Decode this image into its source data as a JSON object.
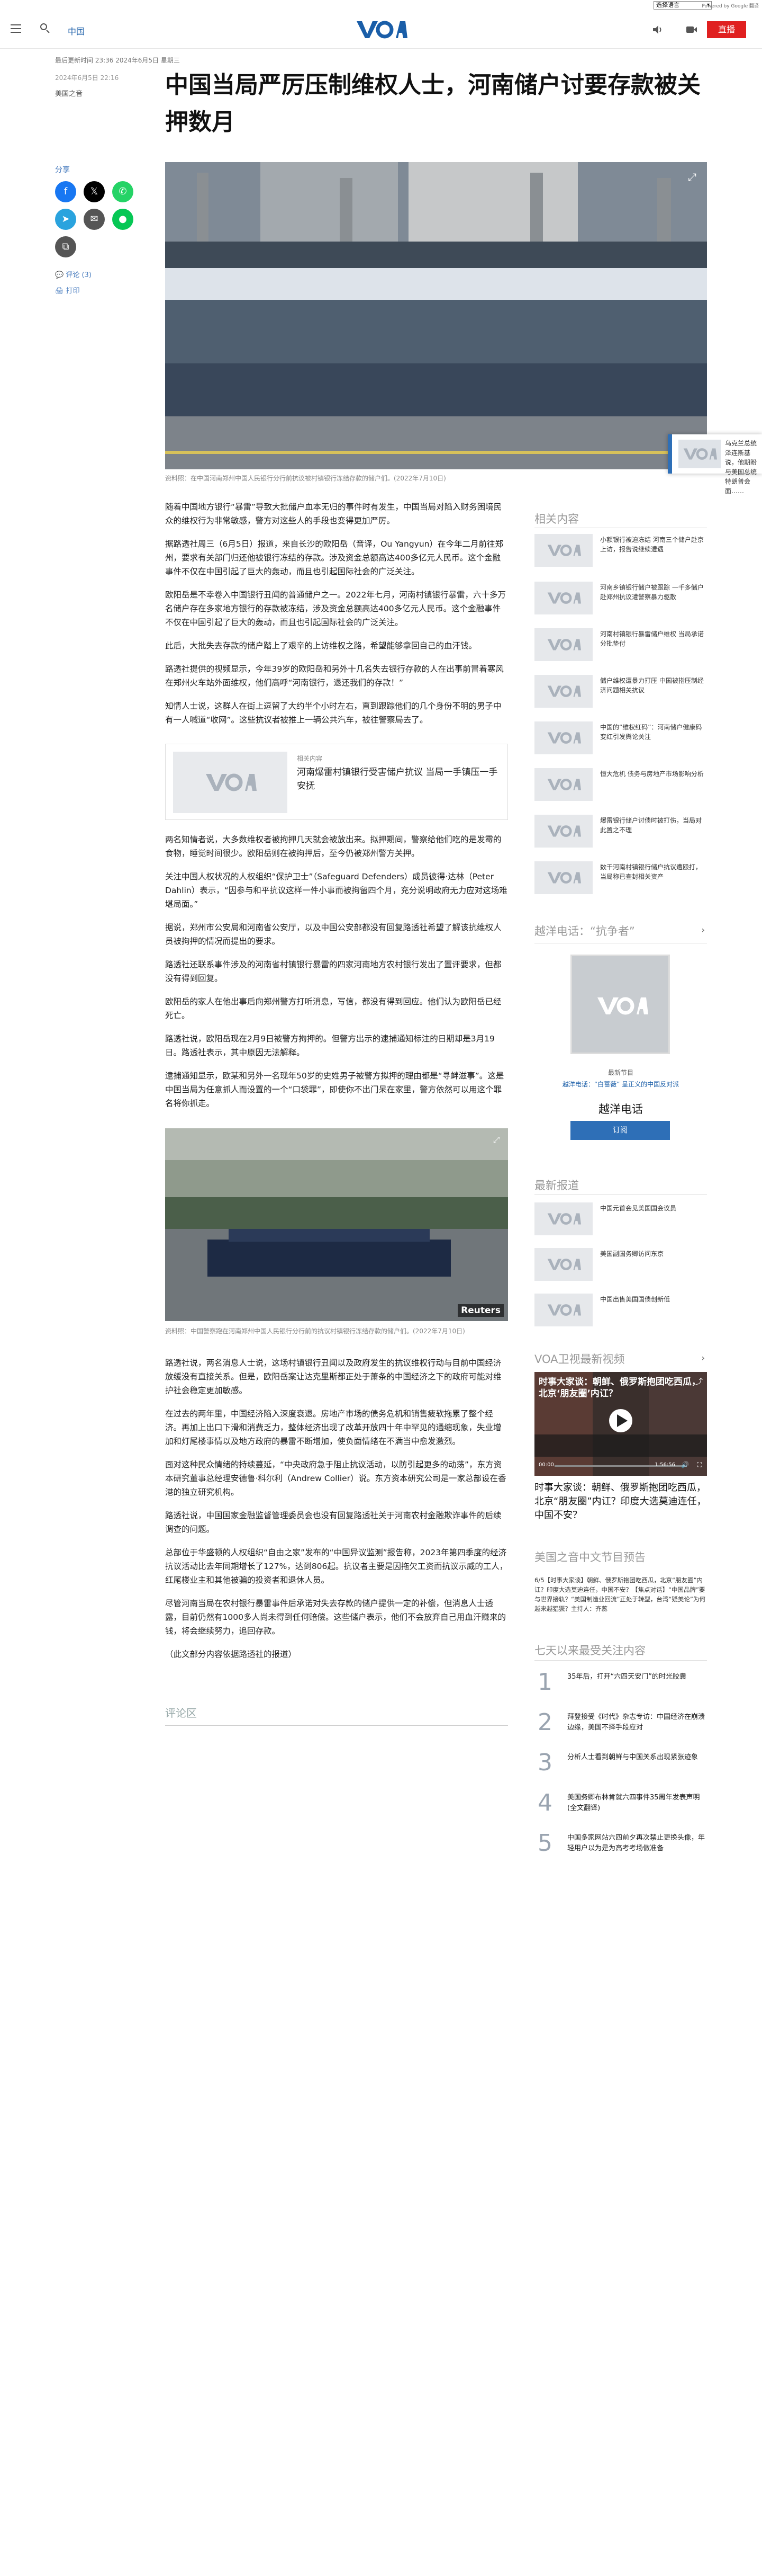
{
  "util": {
    "language_select": "选择语言",
    "google_translate": "Powered by Google 翻译"
  },
  "header": {
    "section": "中国",
    "live_label": "直播"
  },
  "article": {
    "dateline": "最后更新时间 23:36 2024年6月5日 星期三",
    "published": "2024年6月5日 22:16",
    "author": "美国之音",
    "title": "中国当局严厉压制维权人士，河南储户讨要存款被关押数月",
    "hero_caption": "资料照：在中国河南郑州中国人民银行分行前抗议被村镇银行冻结存款的储户们。(2022年7月10日)",
    "paragraphs_a": [
      "随着中国地方银行“暴雷”导致大批储户血本无归的事件时有发生，中国当局对陷入财务困境民众的维权行为非常敏感，警方对这些人的手段也变得更加严厉。",
      "据路透社周三（6月5日）报道，来自长沙的欧阳岳（音译，Ou Yangyun）在今年二月前往郑州，要求有关部门归还他被银行冻结的存款。涉及资金总额高达400多亿元人民币。这个金融事件不仅在中国引起了巨大的轰动，而且也引起国际社会的广泛关注。",
      "欧阳岳是不幸卷入中国银行丑闻的普通储户之一。2022年七月，河南村镇银行暴雷，六十多万名储户存在多家地方银行的存款被冻结，涉及资金总额高达400多亿元人民币。这个金融事件不仅在中国引起了巨大的轰动，而且也引起国际社会的广泛关注。",
      "此后，大批失去存款的储户踏上了艰辛的上访维权之路，希望能够拿回自己的血汗钱。",
      "路透社提供的视频显示，今年39岁的欧阳岳和另外十几名失去银行存款的人在出事前冒着寒风在郑州火车站外面维权，他们高呼“河南银行，退还我们的存款！”",
      "知情人士说，这群人在街上逗留了大约半个小时左右，直到跟踪他们的几个身份不明的男子中有一人喊道“收网”。这些抗议者被推上一辆公共汽车，被往警察局去了。"
    ],
    "related_inline": {
      "kicker": "相关内容",
      "title": "河南爆雷村镇银行受害储户抗议 当局一手镇压一手安抚"
    },
    "paragraphs_b": [
      "两名知情者说，大多数维权者被拘押几天就会被放出来。拟押期间，警察给他们吃的是发霉的食物，睡觉时间很少。欧阳岳则在被拘押后，至今仍被郑州警方关押。",
      "关注中国人权状况的人权组织“保护卫士”（Safeguard Defenders）成员彼得·达林（Peter Dahlin）表示，“因参与和平抗议这样一件小事而被拘留四个月，充分说明政府无力应对这场难堪局面。”",
      "据说，郑州市公安局和河南省公安厅，以及中国公安部都没有回复路透社希望了解该抗维权人员被拘押的情况而提出的要求。",
      "路透社还联系事件涉及的河南省村镇银行暴雷的四家河南地方农村银行发出了置评要求，但都没有得到回复。",
      "欧阳岳的家人在他出事后向郑州警方打听消息，写信，都没有得到回应。他们认为欧阳岳已经死亡。",
      "路透社说，欧阳岳现在2月9日被警方拘押的。但警方出示的逮捕通知标注的日期却是3月19日。路透社表示，其中原因无法解释。",
      "逮捕通知显示，欧某和另外一名现年50岁的史姓男子被警方拟押的理由都是“寻衅滋事”。这是中国当局为任意抓人而设置的一个“口袋罪”，即使你不出门呆在家里，警方依然可以用这个罪名将你抓走。"
    ],
    "image2_caption": "资料照：中国警察跑在河南郑州中国人民银行分行前的抗议村镇银行冻结存款的储户们。(2022年7月10日)",
    "image2_credit": "Reuters",
    "paragraphs_c": [
      "路透社说，两名消息人士说，这场村镇银行丑闻以及政府发生的抗议维权行动与目前中国经济放缓没有直接关系。但是，欧阳岳案让达克里斯都正处于萧条的中国经济之下的政府可能对维护社会稳定更加敏感。",
      "在过去的两年里，中国经济陷入深度衰退。房地产市场的债务危机和销售疲软拖累了整个经济。再加上出口下滑和消费乏力，整体经济出现了改革开放四十年中罕见的通缩现象，失业增加和灯尾楼事情以及地方政府的暴雷不断增加，使负面情绪在不满当中愈发激烈。",
      "面对这种民众情绪的持续蔓延，“中央政府急于阻止抗议活动，以防引起更多的动荡”，东方资本研究董事总经理安德鲁·科尔利（Andrew Collier）说。东方资本研究公司是一家总部设在香港的独立研究机构。",
      "路透社说，中国国家金融监督管理委员会也没有回复路透社关于河南农村金融欺诈事件的后续调查的问题。",
      "总部位于华盛顿的人权组织“自由之家”发布的“中国异议监测”报告称，2023年第四季度的经济抗议活动比去年同期增长了127%，达到806起。抗议者主要是因拖欠工资而抗议示威的工人，红尾楼业主和其他被骗的投资者和退休人员。",
      "尽管河南当局在农村银行暴雷事件后承诺对失去存款的储户提供一定的补偿，但消息人士透露，目前仍然有1000多人尚未得到任何赔偿。这些储户表示，他们不会放弃自己用血汗赚来的钱，将会继续努力，追回存款。",
      "（此文部分内容依据路透社的报道）"
    ],
    "comments_label": "评论区"
  },
  "share": {
    "label": "分享",
    "comment_link": "评论 (3)",
    "print_link": "打印"
  },
  "floating": {
    "text": "乌克兰总统泽连斯基说，他期盼与美国总统特朗普会面……"
  },
  "sidebar": {
    "related_title": "相关内容",
    "related": [
      "小额银行被迫冻结 河南三个储户赴京上访，报告说继续遭遇",
      "河南乡镇银行储户被跟踪 一千多储户赴郑州抗议遭警察暴力驱散",
      "河南村镇银行暴雷储户维权 当局承诺分批垫付",
      "储户维权遭暴力打压 中国被指压制经济问题相关抗议",
      "中国的“维权红码”：河南储户健康码变红引发舆论关注",
      "恒大危机 债务与房地产市场影响分析",
      "爆雷银行储户讨债时被打伤，当局对此置之不理",
      "数千河南村镇银行储户抗议遭殴打，当局称已查封相关资产"
    ],
    "hotline_title": "越洋电话：“抗争者”",
    "hotline_latest": "最新节目",
    "hotline_link": "越洋电话：“白蔷薇” 呈正义的中国反对派",
    "hotline_name": "越洋电话",
    "subscribe_label": "订阅",
    "latest_title": "最新报道",
    "latest": [
      "中国元首会见美国国会议员",
      "美国副国务卿访问东京",
      "中国出售美国国债创新低"
    ],
    "tv_title": "VOA卫视最新视频",
    "tv_video_overlay": "时事大家谈：朝鲜、俄罗斯抱团吃西瓜，北京‘朋友圈’内讧？",
    "tv_video_time": "00:00",
    "tv_video_duration": "1:56:56",
    "tv_caption": "时事大家谈：朝鲜、俄罗斯抱团吃西瓜，北京“朋友圈”内讧？印度大选莫迪连任，中国不安？",
    "program_title": "美国之音中文节目预告",
    "program_text": "6/5【时事大家谈】朝鲜、俄罗斯抱团吃西瓜，北京“朋友圈”内讧？印度大选莫迪连任，中国不安？【焦点对话】“中国品牌”要与世界接轨？“美国制造业回流”正处于转型，台湾“疑美论”为何越来越猖獗？主持人：齐蕊",
    "popular_title": "七天以来最受关注内容",
    "popular": [
      {
        "num": "1",
        "text": "35年后，打开“六四天安门”的时光胶囊"
      },
      {
        "num": "2",
        "text": "拜登接受《时代》杂志专访：中国经济在崩溃边缘，美国不择手段应对"
      },
      {
        "num": "3",
        "text": "分析人士看到朝鲜与中国关系出现紧张迹象"
      },
      {
        "num": "4",
        "text": "美国务卿布林肯就六四事件35周年发表声明(全文翻译)"
      },
      {
        "num": "5",
        "text": "中国多家网站六四前夕再次禁止更换头像，年轻用户以为是为高考考场做准备"
      }
    ]
  },
  "colors": {
    "brand_blue": "#1a5ea8",
    "live_red": "#e02020",
    "accent_blue": "#2e6fb7"
  }
}
